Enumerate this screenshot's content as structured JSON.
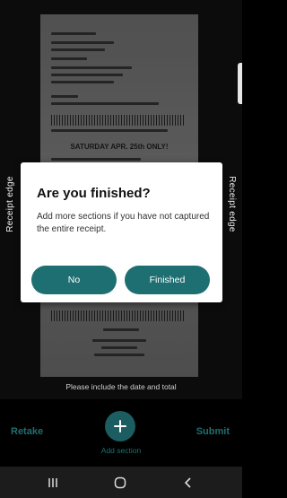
{
  "camera": {
    "receipt_edge_left": "Receipt edge",
    "receipt_edge_right": "Receipt edge",
    "hint": "Please include the date and total",
    "banner_text": "SATURDAY APR. 25th ONLY!"
  },
  "dialog": {
    "title": "Are you finished?",
    "message": "Add more sections if you have not captured the entire receipt.",
    "no_label": "No",
    "finished_label": "Finished"
  },
  "bottom": {
    "retake_label": "Retake",
    "add_section_label": "Add section",
    "submit_label": "Submit"
  },
  "icons": {
    "add": "plus-icon",
    "recents": "recents-icon",
    "home": "home-icon",
    "back": "back-icon"
  },
  "colors": {
    "accent": "#1e6f72",
    "accent_dark": "#1b5d60"
  }
}
